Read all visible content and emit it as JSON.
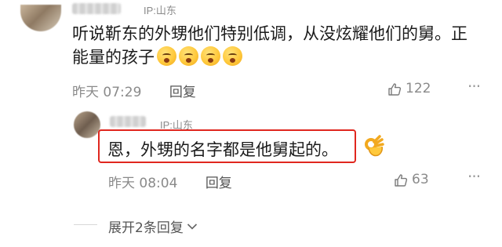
{
  "comment": {
    "ip": "IP:山东",
    "text": "听说靳东的外甥他们特别低调，从没炫耀他们的舅。正能量的孩子",
    "emojis": [
      "crying-face-icon",
      "crying-face-icon",
      "crying-face-icon",
      "crying-face-icon"
    ],
    "time": "昨天 07:29",
    "reply_label": "回复",
    "likes": "122"
  },
  "reply": {
    "ip": "IP:山东",
    "text": "恩，外甥的名字都是他舅起的。",
    "emoji": "ok-hand-icon",
    "time": "昨天 08:04",
    "reply_label": "回复",
    "likes": "63",
    "highlight_color": "#e0271f"
  },
  "expand": {
    "label": "展开2条回复"
  }
}
